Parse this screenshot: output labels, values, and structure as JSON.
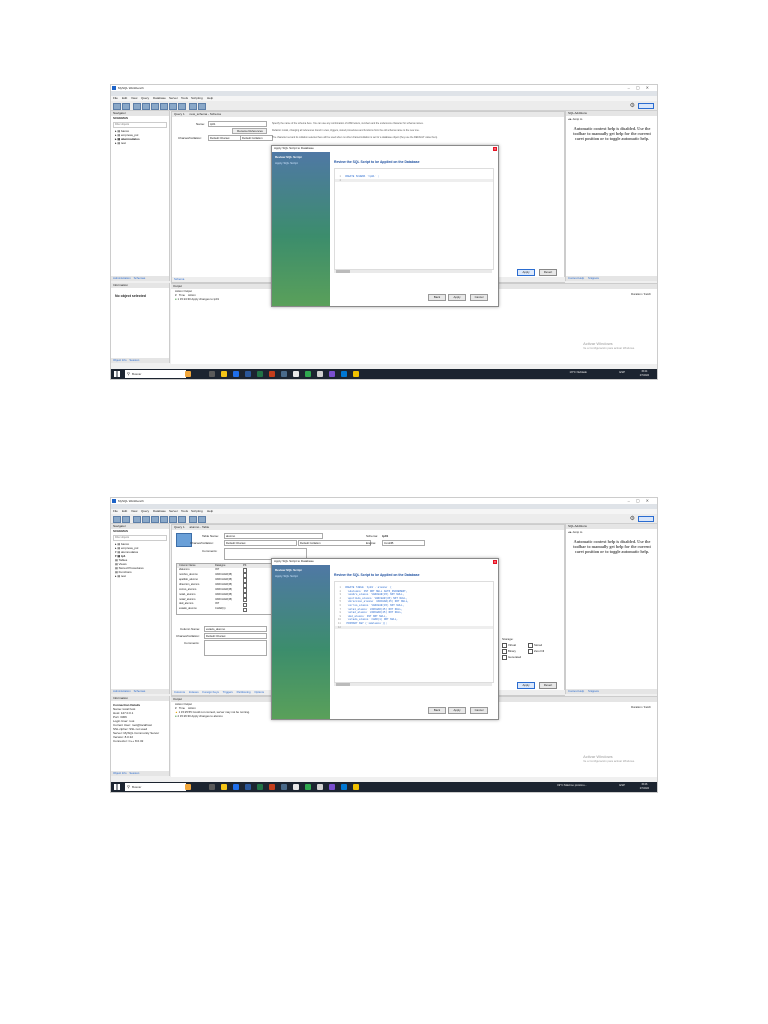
{
  "app": {
    "window_title": "MySQL Workbench",
    "connection_tab": "localhost - Warning - not sup",
    "menu": [
      "File",
      "Edit",
      "View",
      "Query",
      "Database",
      "Server",
      "Tools",
      "Scripting",
      "Help"
    ]
  },
  "navigator": {
    "header": "Navigator",
    "schemas_title": "SCHEMAS",
    "filter_placeholder": "Filter objects",
    "shot1_tree": [
      "▸ ▤ banco",
      "▸ ▤ empresa_pol",
      "▸ ▤ alumnodatos",
      "▸ ▤ test"
    ],
    "shot2_tree": [
      "▸ ▤ banco",
      "▸ ▤ empresa_pol",
      "▾ ▤ alumnodatos",
      "▾ ▤ tp1",
      "    ▤ Tables",
      "    ▤ Views",
      "    ▤ Stored Procedures",
      "    ▤ Functions",
      "▸ ▤ test"
    ]
  },
  "pane_tabs": {
    "administration": "Administration",
    "schemas": "Schemas",
    "object_info": "Object Info",
    "session": "Session"
  },
  "information": {
    "header": "Information",
    "no_object": "No object selected",
    "connection_lines": [
      "Connection Details",
      "Name: local host",
      "Host: 127.0.0.1",
      "Port: 3306",
      "Login User: root",
      "Current User: root@localhost",
      "SSL cipher: SSL not used",
      "Server: MySQL Community Server",
      "Version: 8.0.32",
      "Connector: C++ 8.0.32"
    ]
  },
  "editor": {
    "shot1_tab": "Query 1",
    "shot1_tab2": "new_schema - Schema",
    "shot2_tab": "Query 1",
    "shot2_tab2": "alumno - Table",
    "schema_name_label": "Name:",
    "schema_name_value": "tp01",
    "rename_button": "Rename References",
    "charset_label": "Charset/Collation:",
    "charset_value": "Default Charset",
    "collation_value": "Default Collation",
    "help_line1": "Specify the name of the schema here. You can use any combination of ANSI letters, numbers and the underscore character for schema names.",
    "help_line2": "Refactor model, changing all references found in view, triggers, stored procedures and functions from the old schema name to the new one.",
    "help_line3": "The character set and its collation selected here will be used when no other charset/collation is set for a database object (they use the DEFAULT value then).",
    "bottom_tab": "Schema",
    "table_name_label": "Table Name:",
    "table_name_value": "alumno",
    "schema_label": "Schema:",
    "schema_value": "tp01",
    "engine_label": "Engine:",
    "engine_value": "InnoDB",
    "comments_label": "Comments:",
    "grid_headers": [
      "Column Name",
      "Datatype",
      "PK"
    ],
    "columns": [
      {
        "name": "idalumno",
        "type": "INT"
      },
      {
        "name": "nombre_alumno",
        "type": "VARCHAR(45)"
      },
      {
        "name": "apellido_alumno",
        "type": "VARCHAR(45)"
      },
      {
        "name": "direccion_alumno",
        "type": "VARCHAR(45)"
      },
      {
        "name": "correo_alumno",
        "type": "VARCHAR(45)"
      },
      {
        "name": "nota1_alumno",
        "type": "VARCHAR(45)"
      },
      {
        "name": "nota2_alumno",
        "type": "VARCHAR(45)"
      },
      {
        "name": "ded_alumno",
        "type": "INT"
      },
      {
        "name": "estado_alumno",
        "type": "CHAR(1)"
      }
    ],
    "column_name_label": "Column Name:",
    "column_name_value": "estado_alumno",
    "charset_collation2_label": "Charset/Collation:",
    "column_comments_label": "Comments:",
    "storage_label": "Storage:",
    "storage_options": [
      "Virtual",
      "Stored",
      "Primary Key",
      "Not Null",
      "Unique",
      "Binary",
      "Unsigned",
      "Zero Fill",
      "Generated"
    ],
    "table_tabs": [
      "Columns",
      "Indexes",
      "Foreign Keys",
      "Triggers",
      "Partitioning",
      "Options"
    ],
    "apply_button": "Apply",
    "revert_button": "Revert"
  },
  "output": {
    "header": "Output",
    "mode": "Action Output",
    "columns": [
      "#",
      "Time",
      "Action"
    ],
    "shot1_rows": [
      [
        "1",
        "15:24:30",
        "Apply changes to tp01"
      ]
    ],
    "shot2_rows": [
      [
        "1",
        "15:25:55",
        "Could not connect, server may not be running."
      ],
      [
        "2",
        "15:26:30",
        "Apply changes to alumno"
      ]
    ],
    "duration_label": "Duration / Fetch"
  },
  "sql_help": {
    "header": "SQL Additions",
    "jump_label": "Jump to",
    "message": "Automatic context help is disabled. Use the toolbar to manually get help for the current caret position or to toggle automatic help.",
    "tabs": [
      "Context Help",
      "Snippets"
    ]
  },
  "dialog": {
    "title": "Apply SQL Script to Database",
    "step1": "Review SQL Script",
    "step2": "Apply SQL Script",
    "heading": "Review the SQL Script to be Applied on the Database",
    "shot1_code": [
      "CREATE SCHEMA `tp01` ;",
      ""
    ],
    "shot2_code": [
      "CREATE TABLE `tp01`.`alumno` (",
      "  `idalumno` INT NOT NULL AUTO_INCREMENT,",
      "  `nombre_alumno` VARCHAR(45) NOT NULL,",
      "  `apellido_alumno` VARCHAR(45) NOT NULL,",
      "  `direccion_alumno` VARCHAR(45) NOT NULL,",
      "  `correo_alumno` VARCHAR(45) NOT NULL,",
      "  `nota1_alumno` VARCHAR(45) NOT NULL,",
      "  `nota2_alumno` VARCHAR(45) NOT NULL,",
      "  `ded_alumno` INT NOT NULL,",
      "  `estado_alumno` CHAR(1) NOT NULL,",
      "  PRIMARY KEY (`idalumno`));",
      ""
    ],
    "back_button": "Back",
    "apply_button": "Apply",
    "cancel_button": "Cancel"
  },
  "watermark": {
    "title": "Activar Windows",
    "subtitle": "Ve a Configuración para activar Windows."
  },
  "taskbar": {
    "search_placeholder": "Buscar",
    "shot1_weather": "19°C Nublado",
    "shot2_weather": "19°C Máximo próximo...",
    "shot1_time": "15:24",
    "shot2_time": "15:26",
    "date": "2/7/2024",
    "lang": "ESP"
  },
  "colors": {
    "accent": "#2b6cd0",
    "dialog_gradient_top": "#4f78a5",
    "dialog_gradient_bottom": "#5aa05a",
    "taskbar": "#1c2430",
    "close_red": "#e81123"
  }
}
